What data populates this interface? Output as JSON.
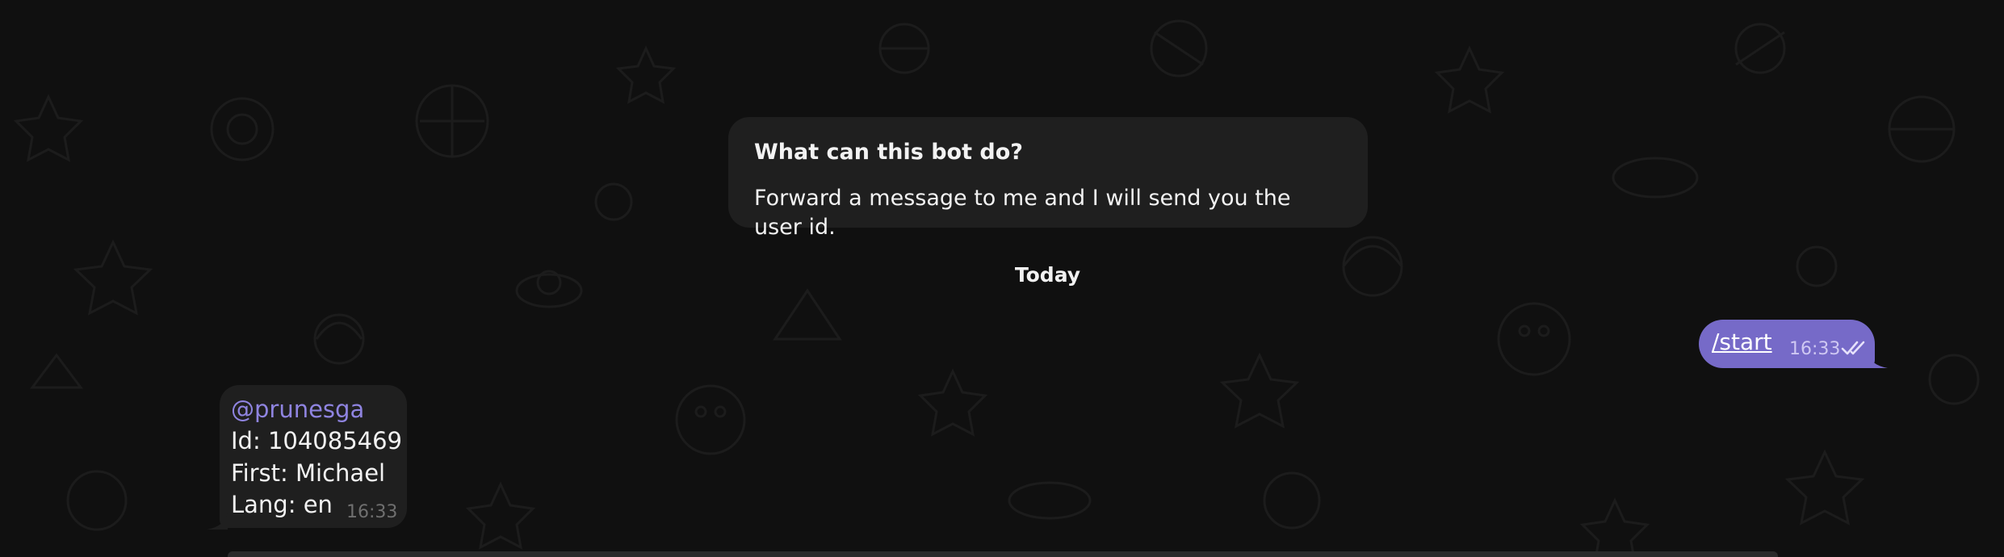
{
  "chat": {
    "bot_info": {
      "title": "What can this bot do?",
      "description": "Forward a message to me and I will send you the user id."
    },
    "date_separator": "Today",
    "outgoing": {
      "text": "/start",
      "time": "16:33",
      "status_icon": "double-check-icon"
    },
    "incoming": {
      "mention": "@prunesga",
      "id_line": "Id: 104085469",
      "first_line": "First: Michael",
      "lang_line": "Lang: en",
      "time": "16:33"
    }
  },
  "colors": {
    "background": "#101010",
    "bubble_in": "#1f1f1f",
    "bubble_out": "#766ac8",
    "mention": "#8f84e0"
  }
}
